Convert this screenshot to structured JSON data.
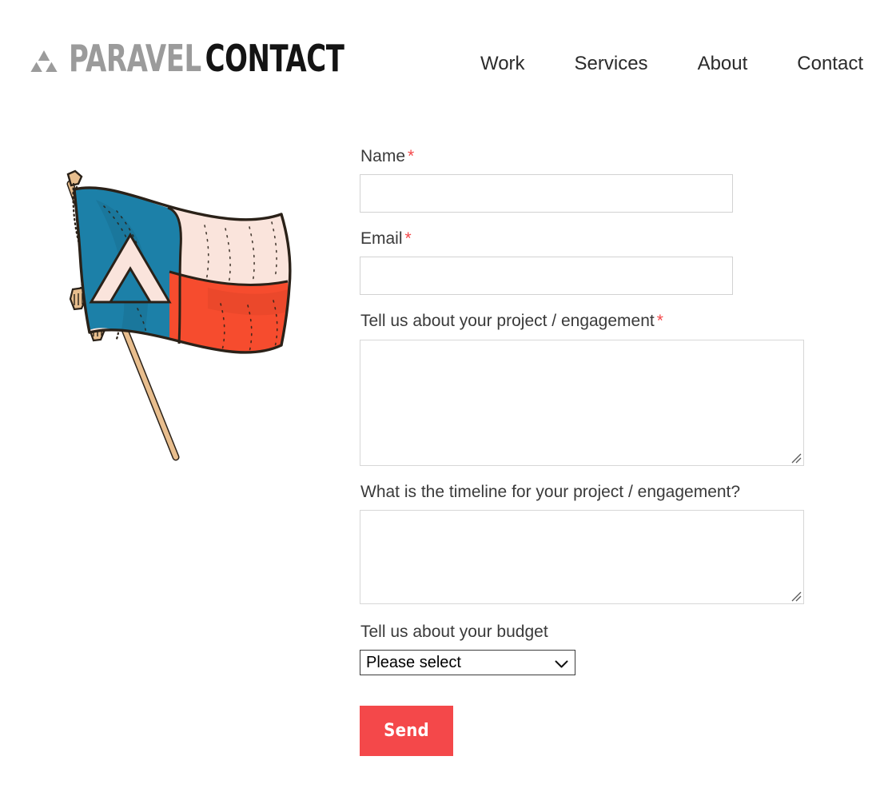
{
  "colors": {
    "accent_red": "#f4484a",
    "brand_gray": "#9b9b9b",
    "brand_black": "#141414",
    "text": "#2b2b2b",
    "input_border": "#d2d2d2",
    "select_border": "#3c3c3c",
    "flag_blue": "#1c80a8",
    "flag_red": "#f64c2e",
    "flag_cream": "#fae4dc",
    "flag_pole": "#e8be8e"
  },
  "header": {
    "logo_icon": "sierpinski-triangle-icon",
    "brand_name": "PARAVEL",
    "section_name": "CONTACT",
    "nav": [
      {
        "label": "Work"
      },
      {
        "label": "Services"
      },
      {
        "label": "About"
      },
      {
        "label": "Contact"
      }
    ]
  },
  "illustration": {
    "name": "paravel-texas-flag-illustration",
    "alt": "Hand-drawn Texas-style flag with Paravel triangle emblem on a tasselled pole"
  },
  "form": {
    "fields": {
      "name": {
        "label": "Name",
        "required": true,
        "required_marker": "*",
        "value": "",
        "placeholder": ""
      },
      "email": {
        "label": "Email",
        "required": true,
        "required_marker": "*",
        "value": "",
        "placeholder": ""
      },
      "project": {
        "label": "Tell us about your project / engagement",
        "required": true,
        "required_marker": "*",
        "value": "",
        "placeholder": ""
      },
      "timeline": {
        "label": "What is the timeline for your project / engagement?",
        "required": false,
        "value": "",
        "placeholder": ""
      },
      "budget": {
        "label": "Tell us about your budget",
        "required": false,
        "selected": "Please select",
        "options": [
          "Please select"
        ]
      }
    },
    "submit_label": "Send"
  }
}
